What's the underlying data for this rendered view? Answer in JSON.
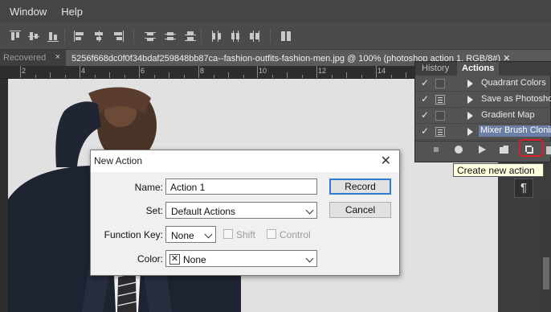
{
  "menubar": {
    "items": [
      "Window",
      "Help"
    ]
  },
  "document": {
    "inactive_tab": "Recovered",
    "inactive_tab_close": "×",
    "active_tab": "5256f668dc0f0f34bdaf259848bb87ca--fashion-outfits-fashion-men.jpg @ 100% (photoshop action 1, RGB/8#) ✕"
  },
  "ruler": {
    "labels": [
      "2",
      "4",
      "6",
      "8",
      "10",
      "12",
      "14"
    ]
  },
  "actions_panel": {
    "tabs": [
      "History",
      "Actions"
    ],
    "active_tab": "Actions",
    "rows": [
      {
        "check": "✓",
        "dialog": false,
        "label": "Quadrant Colors",
        "selected": false
      },
      {
        "check": "✓",
        "dialog": true,
        "label": "Save as Photoshop",
        "selected": false
      },
      {
        "check": "✓",
        "dialog": false,
        "label": "Gradient Map",
        "selected": false
      },
      {
        "check": "✓",
        "dialog": true,
        "label": "Mixer Brush Cloning",
        "selected": true
      }
    ],
    "buttons": [
      "stop-icon",
      "record-icon",
      "play-icon",
      "folder-icon",
      "new-action-icon",
      "trash-icon"
    ]
  },
  "tooltip": {
    "text": "Create new action"
  },
  "dialog": {
    "title": "New Action",
    "close": "✕",
    "name_label": "Name:",
    "name_value": "Action 1",
    "set_label": "Set:",
    "set_value": "Default Actions",
    "function_key_label": "Function Key:",
    "function_key_value": "None",
    "shift_label": "Shift",
    "control_label": "Control",
    "color_label": "Color:",
    "color_value": "None",
    "color_swatch": "✕",
    "record_button": "Record",
    "cancel_button": "Cancel"
  },
  "side_panel": {
    "paragraph_icon": "¶"
  },
  "colors": {
    "accent_selected": "#6b7fa6",
    "highlight_ring": "#d8202a",
    "tooltip_bg": "#ffffe1",
    "default_button_border": "#2f7bd2"
  }
}
